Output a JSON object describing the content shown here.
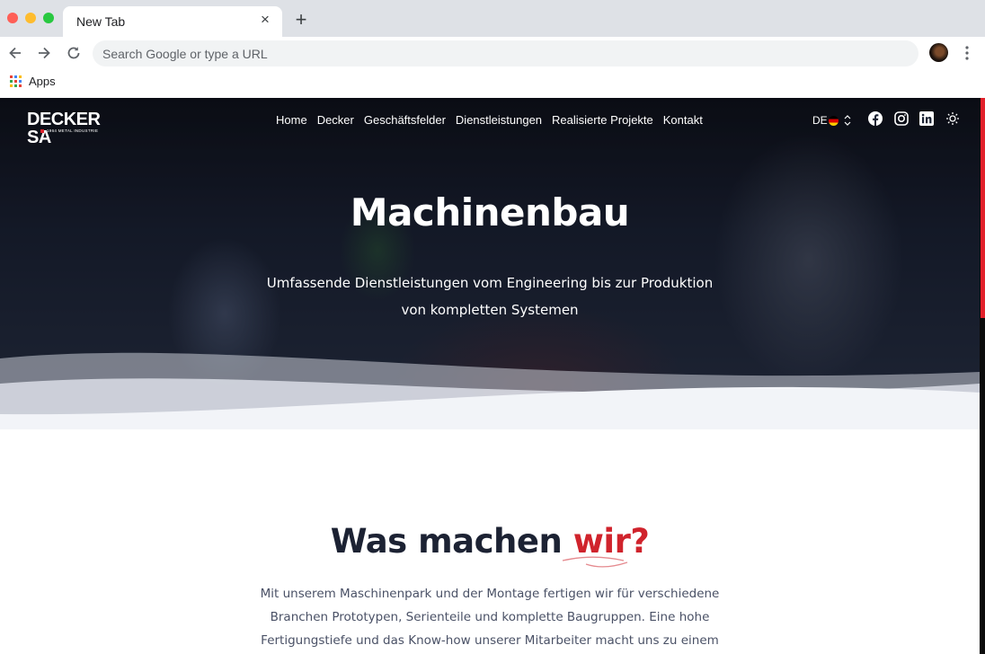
{
  "browser": {
    "tab_title": "New Tab",
    "tab_close": "×",
    "new_tab": "+",
    "omnibox_placeholder": "Search Google or type a URL",
    "bookmarks": {
      "apps_label": "Apps"
    }
  },
  "site": {
    "logo": {
      "text": "DECKER SA",
      "subtitle": "1964 METAL INDUSTRIE"
    },
    "nav": [
      "Home",
      "Decker",
      "Geschäftsfelder",
      "Dienstleistungen",
      "Realisierte Projekte",
      "Kontakt"
    ],
    "language": {
      "code": "DE"
    },
    "social": [
      "facebook-icon",
      "instagram-icon",
      "linkedin-icon"
    ],
    "hero": {
      "title": "Machinenbau",
      "subtitle_line1": "Umfassende Dienstleistungen vom Engineering bis zur Produktion",
      "subtitle_line2": "von kompletten Systemen"
    },
    "section": {
      "title_main": "Was machen ",
      "title_accent": "wir?",
      "text_line1": "Mit unserem Maschinenpark und der Montage fertigen wir für verschiedene",
      "text_line2": "Branchen Prototypen, Serienteile und komplette Baugruppen. Eine hohe",
      "text_line3": "Fertigungstiefe und das Know-how unserer Mitarbeiter macht uns zu einem flexiblen"
    },
    "colors": {
      "accent": "#d0232c",
      "heading": "#1c2233",
      "text": "#4a5166"
    }
  }
}
